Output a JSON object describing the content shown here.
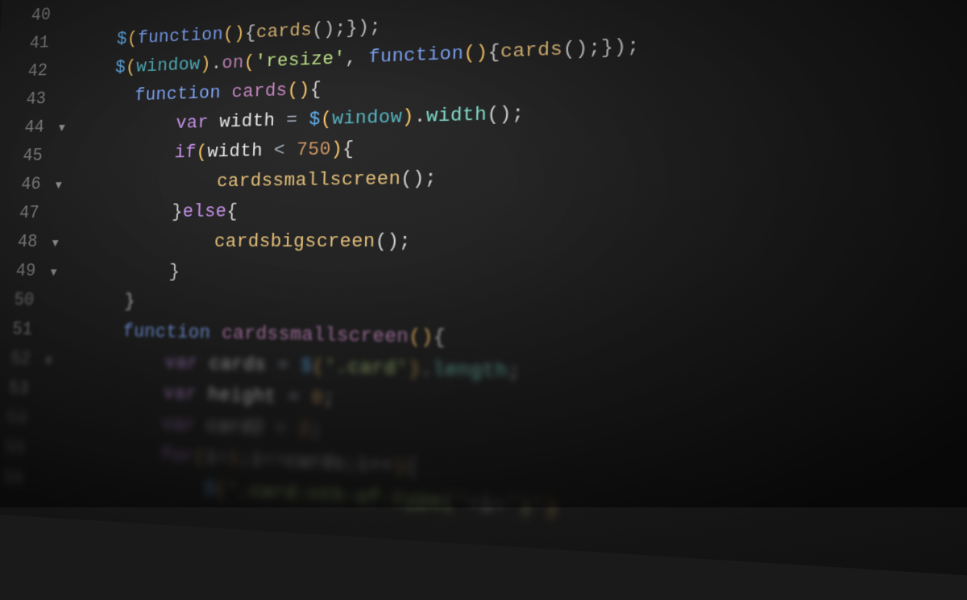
{
  "lines": [
    {
      "num": "40",
      "fold": "",
      "tokens": []
    },
    {
      "num": "41",
      "fold": "",
      "tokens": [
        {
          "t": "    ",
          "c": "white"
        },
        {
          "t": "$",
          "c": "dollar"
        },
        {
          "t": "(",
          "c": "paren"
        },
        {
          "t": "function",
          "c": "kw2"
        },
        {
          "t": "()",
          "c": "paren"
        },
        {
          "t": "{",
          "c": "punct"
        },
        {
          "t": "cards",
          "c": "fn"
        },
        {
          "t": "();",
          "c": "punct"
        },
        {
          "t": "}",
          "c": "punct"
        },
        {
          "t": ");",
          "c": "punct"
        }
      ]
    },
    {
      "num": "42",
      "fold": "",
      "tokens": [
        {
          "t": "    ",
          "c": "white"
        },
        {
          "t": "$",
          "c": "dollar"
        },
        {
          "t": "(",
          "c": "paren"
        },
        {
          "t": "window",
          "c": "var"
        },
        {
          "t": ")",
          "c": "paren"
        },
        {
          "t": ".",
          "c": "punct"
        },
        {
          "t": "on",
          "c": "fn2"
        },
        {
          "t": "(",
          "c": "paren"
        },
        {
          "t": "'resize'",
          "c": "str"
        },
        {
          "t": ", ",
          "c": "punct"
        },
        {
          "t": "function",
          "c": "kw2"
        },
        {
          "t": "()",
          "c": "paren"
        },
        {
          "t": "{",
          "c": "punct"
        },
        {
          "t": "cards",
          "c": "fn"
        },
        {
          "t": "();",
          "c": "punct"
        },
        {
          "t": "}",
          "c": "punct"
        },
        {
          "t": ");",
          "c": "punct"
        }
      ]
    },
    {
      "num": "43",
      "fold": "",
      "tokens": [
        {
          "t": "      ",
          "c": "white"
        },
        {
          "t": "function",
          "c": "kw2"
        },
        {
          "t": " ",
          "c": "white"
        },
        {
          "t": "cards",
          "c": "fn2"
        },
        {
          "t": "()",
          "c": "paren"
        },
        {
          "t": "{",
          "c": "punct"
        }
      ]
    },
    {
      "num": "44",
      "fold": "▼",
      "tokens": [
        {
          "t": "          ",
          "c": "white"
        },
        {
          "t": "var",
          "c": "kw"
        },
        {
          "t": " ",
          "c": "white"
        },
        {
          "t": "width",
          "c": "white"
        },
        {
          "t": " = ",
          "c": "op"
        },
        {
          "t": "$",
          "c": "dollar"
        },
        {
          "t": "(",
          "c": "paren"
        },
        {
          "t": "window",
          "c": "var"
        },
        {
          "t": ")",
          "c": "paren"
        },
        {
          "t": ".",
          "c": "punct"
        },
        {
          "t": "width",
          "c": "prop"
        },
        {
          "t": "();",
          "c": "punct"
        }
      ]
    },
    {
      "num": "45",
      "fold": "",
      "tokens": [
        {
          "t": "          ",
          "c": "white"
        },
        {
          "t": "if",
          "c": "kw"
        },
        {
          "t": "(",
          "c": "paren"
        },
        {
          "t": "width",
          "c": "white"
        },
        {
          "t": " < ",
          "c": "op"
        },
        {
          "t": "750",
          "c": "num"
        },
        {
          "t": ")",
          "c": "paren"
        },
        {
          "t": "{",
          "c": "punct"
        }
      ]
    },
    {
      "num": "46",
      "fold": "▼",
      "tokens": [
        {
          "t": "              ",
          "c": "white"
        },
        {
          "t": "cardssmallscreen",
          "c": "fn"
        },
        {
          "t": "();",
          "c": "punct"
        }
      ]
    },
    {
      "num": "47",
      "fold": "",
      "tokens": [
        {
          "t": "          ",
          "c": "white"
        },
        {
          "t": "}",
          "c": "punct"
        },
        {
          "t": "else",
          "c": "kw"
        },
        {
          "t": "{",
          "c": "punct"
        }
      ]
    },
    {
      "num": "48",
      "fold": "▼",
      "tokens": [
        {
          "t": "              ",
          "c": "white"
        },
        {
          "t": "cardsbigscreen",
          "c": "fn"
        },
        {
          "t": "();",
          "c": "punct"
        }
      ]
    },
    {
      "num": "49",
      "fold": "▼",
      "tokens": [
        {
          "t": "          ",
          "c": "white"
        },
        {
          "t": "}",
          "c": "punct"
        }
      ]
    },
    {
      "num": "50",
      "fold": "",
      "tokens": [
        {
          "t": "      ",
          "c": "white"
        },
        {
          "t": "}",
          "c": "punct"
        }
      ]
    },
    {
      "num": "51",
      "fold": "",
      "tokens": [
        {
          "t": "      ",
          "c": "white"
        },
        {
          "t": "function",
          "c": "kw2"
        },
        {
          "t": " ",
          "c": "white"
        },
        {
          "t": "cardssmallscreen",
          "c": "fn2"
        },
        {
          "t": "()",
          "c": "paren"
        },
        {
          "t": "{",
          "c": "punct"
        }
      ]
    },
    {
      "num": "52",
      "fold": "▼",
      "tokens": [
        {
          "t": "          ",
          "c": "white"
        },
        {
          "t": "var",
          "c": "kw"
        },
        {
          "t": " ",
          "c": "white"
        },
        {
          "t": "cards",
          "c": "white"
        },
        {
          "t": " = ",
          "c": "op"
        },
        {
          "t": "$",
          "c": "dollar"
        },
        {
          "t": "(",
          "c": "paren"
        },
        {
          "t": "'.card'",
          "c": "str"
        },
        {
          "t": ")",
          "c": "paren"
        },
        {
          "t": ".",
          "c": "punct"
        },
        {
          "t": "length",
          "c": "prop"
        },
        {
          "t": ";",
          "c": "punct"
        }
      ]
    },
    {
      "num": "53",
      "fold": "",
      "tokens": [
        {
          "t": "          ",
          "c": "white"
        },
        {
          "t": "var",
          "c": "kw"
        },
        {
          "t": " ",
          "c": "white"
        },
        {
          "t": "height",
          "c": "white"
        },
        {
          "t": " = ",
          "c": "op"
        },
        {
          "t": "0",
          "c": "num"
        },
        {
          "t": ";",
          "c": "punct"
        }
      ]
    },
    {
      "num": "54",
      "fold": "",
      "tokens": [
        {
          "t": "          ",
          "c": "white"
        },
        {
          "t": "var",
          "c": "kw"
        },
        {
          "t": " ",
          "c": "white"
        },
        {
          "t": "card2",
          "c": "white"
        },
        {
          "t": " = ",
          "c": "op"
        },
        {
          "t": "2",
          "c": "num"
        },
        {
          "t": ";",
          "c": "punct"
        }
      ]
    },
    {
      "num": "55",
      "fold": "",
      "tokens": [
        {
          "t": "          ",
          "c": "white"
        },
        {
          "t": "for",
          "c": "kw"
        },
        {
          "t": "(",
          "c": "paren"
        },
        {
          "t": "i",
          "c": "white"
        },
        {
          "t": "=",
          "c": "op"
        },
        {
          "t": "1",
          "c": "num"
        },
        {
          "t": ";",
          "c": "punct"
        },
        {
          "t": "i",
          "c": "white"
        },
        {
          "t": "<=",
          "c": "op"
        },
        {
          "t": "cards",
          "c": "white"
        },
        {
          "t": ";",
          "c": "punct"
        },
        {
          "t": "i++",
          "c": "white"
        },
        {
          "t": ")",
          "c": "paren"
        },
        {
          "t": "{",
          "c": "punct"
        }
      ]
    },
    {
      "num": "56",
      "fold": "",
      "tokens": [
        {
          "t": "              ",
          "c": "white"
        },
        {
          "t": "$",
          "c": "dollar"
        },
        {
          "t": "(",
          "c": "paren"
        },
        {
          "t": "'.card:nth-of-type('",
          "c": "str"
        },
        {
          "t": "+",
          "c": "op"
        },
        {
          "t": "i",
          "c": "white"
        },
        {
          "t": "+",
          "c": "op"
        },
        {
          "t": "')'",
          "c": "str"
        },
        {
          "t": ")",
          "c": "paren"
        }
      ]
    }
  ]
}
